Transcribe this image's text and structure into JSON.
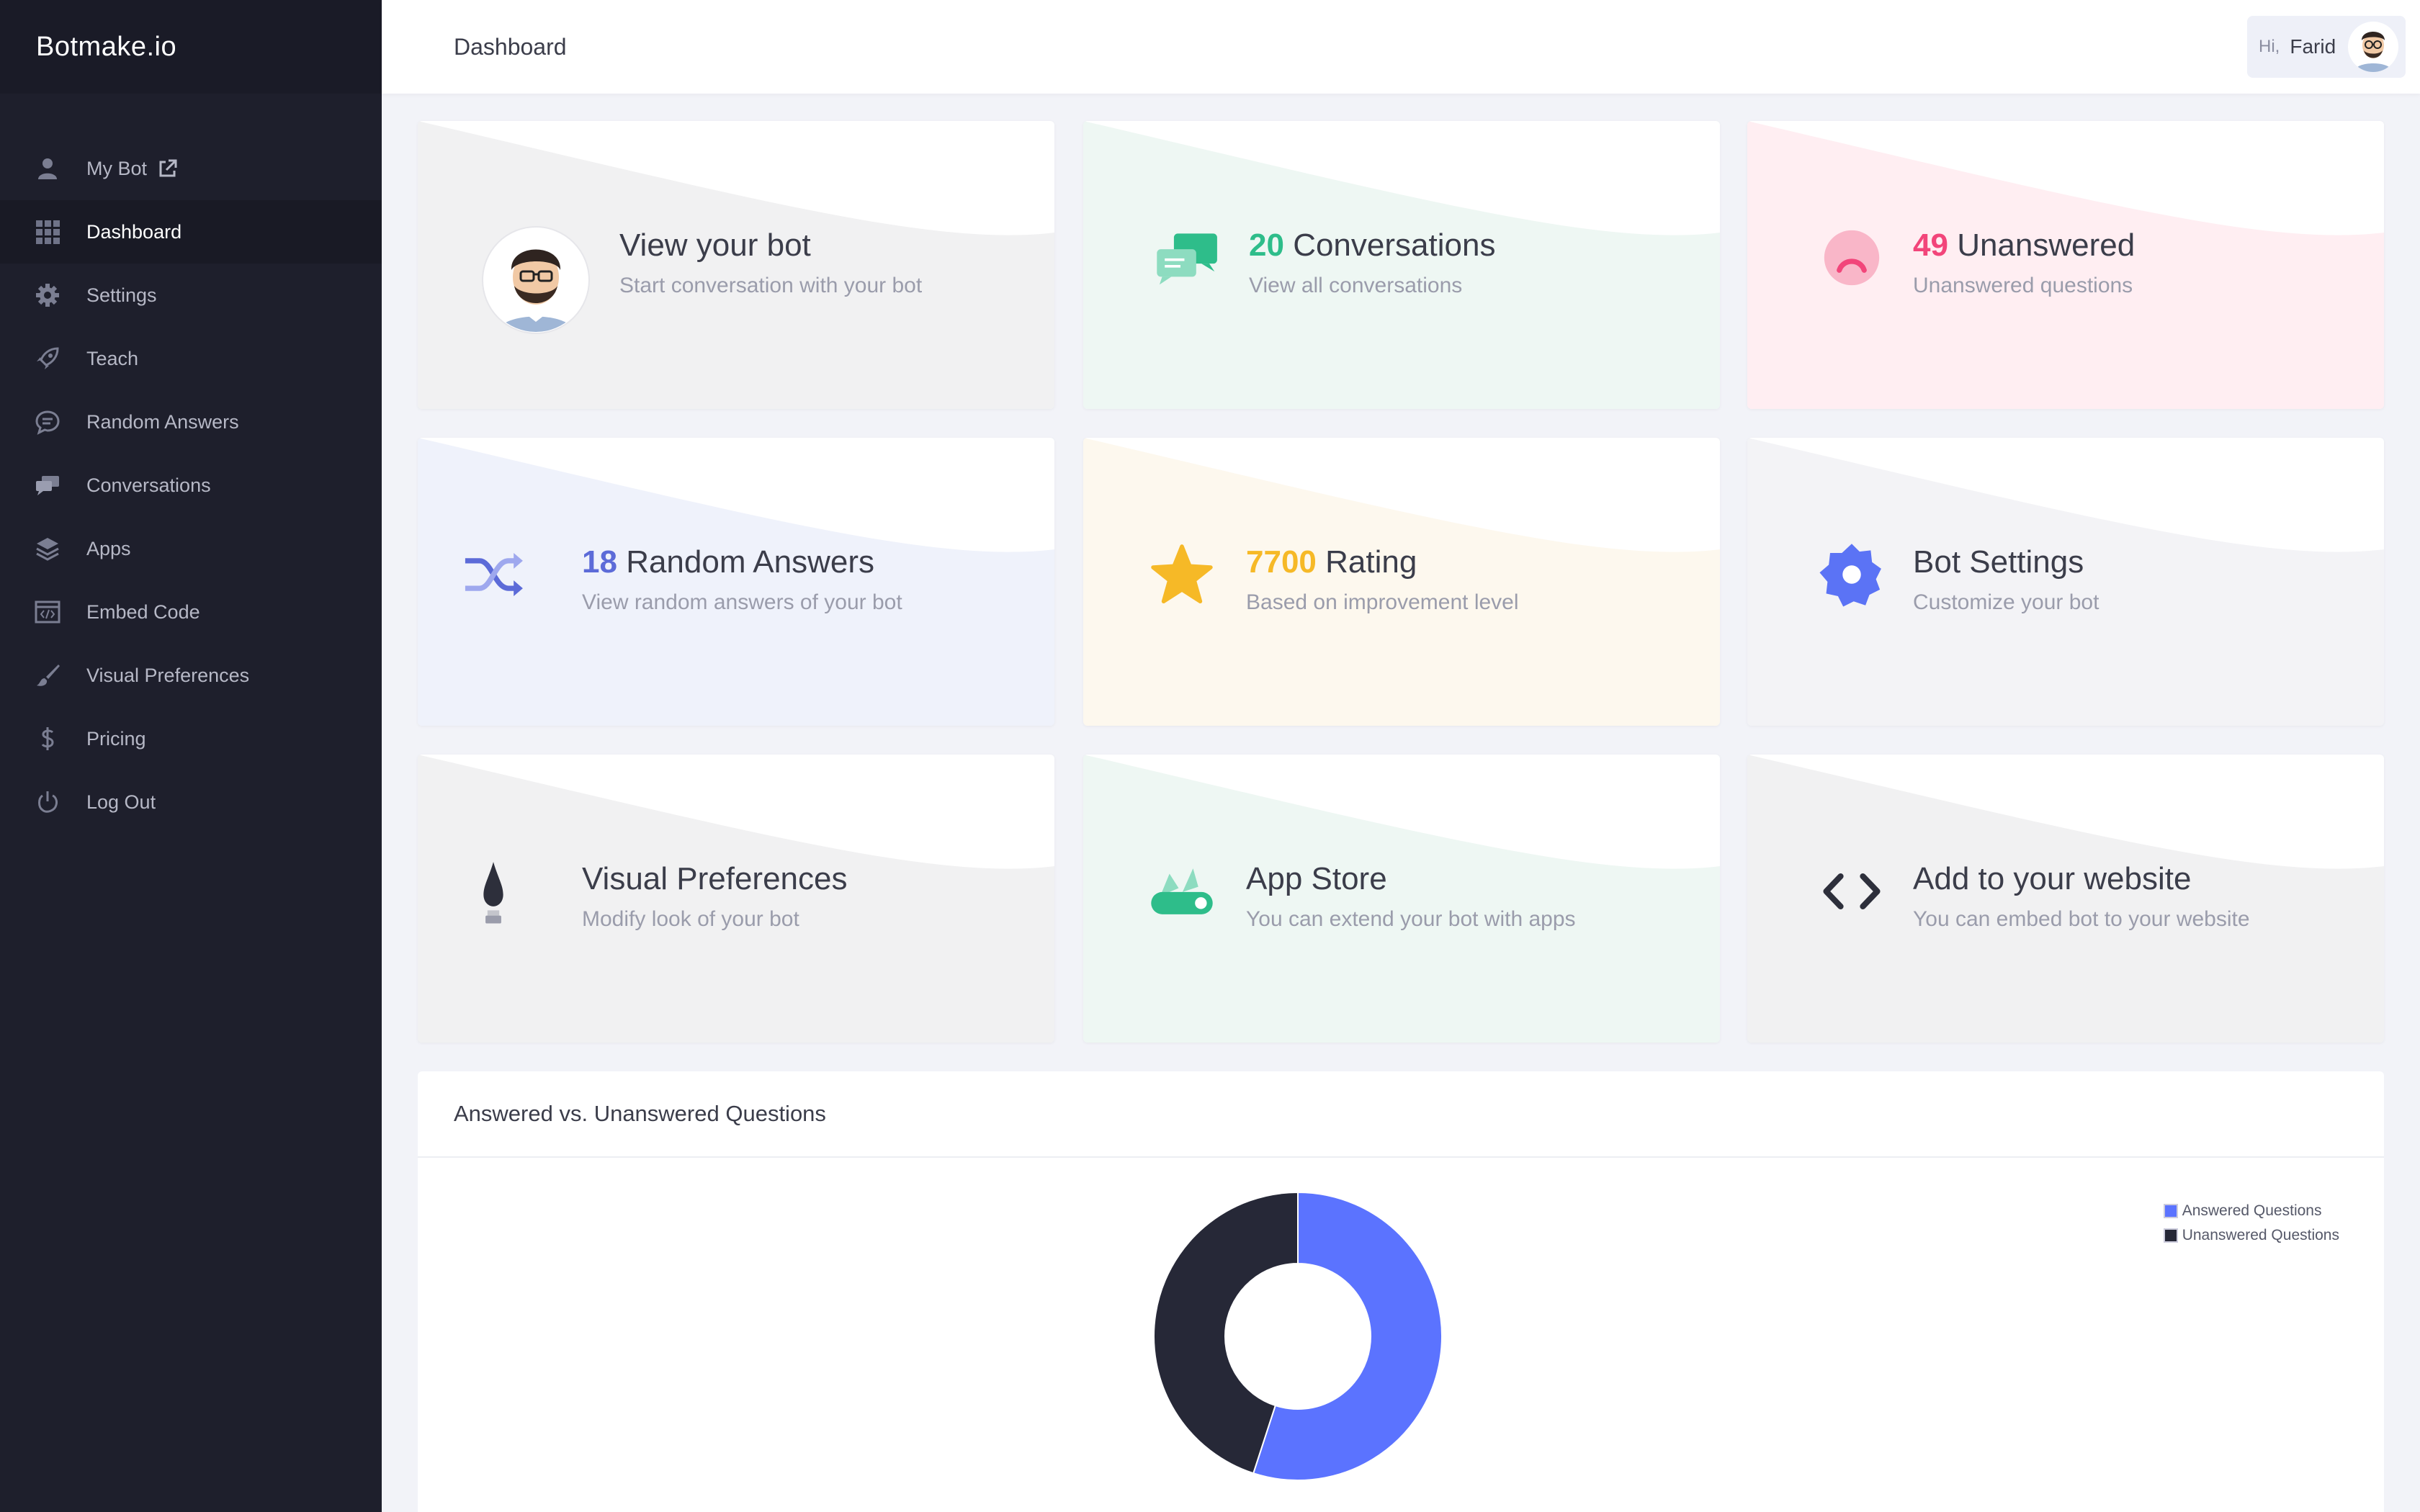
{
  "brand": "Botmake.io",
  "header": {
    "title": "Dashboard",
    "greeting": "Hi,",
    "user_name": "Farid"
  },
  "sidebar": {
    "items": [
      {
        "label": "My Bot",
        "icon": "user-icon"
      },
      {
        "label": "Dashboard",
        "icon": "grid-icon",
        "active": true
      },
      {
        "label": "Settings",
        "icon": "gear-icon"
      },
      {
        "label": "Teach",
        "icon": "rocket-icon"
      },
      {
        "label": "Random Answers",
        "icon": "chat-bubble-icon"
      },
      {
        "label": "Conversations",
        "icon": "comments-icon"
      },
      {
        "label": "Apps",
        "icon": "layers-icon"
      },
      {
        "label": "Embed Code",
        "icon": "code-window-icon"
      },
      {
        "label": "Visual Preferences",
        "icon": "brush-icon"
      },
      {
        "label": "Pricing",
        "icon": "dollar-icon"
      },
      {
        "label": "Log Out",
        "icon": "power-icon"
      }
    ]
  },
  "cards": [
    {
      "num": "",
      "title": "View your bot",
      "sub": "Start conversation with your bot",
      "icon": "bot-avatar-icon",
      "color": "#3b3d4a"
    },
    {
      "num": "20",
      "title": "Conversations",
      "sub": "View all conversations",
      "icon": "conversations-icon",
      "color": "#2ebd8a"
    },
    {
      "num": "49",
      "title": "Unanswered",
      "sub": "Unanswered questions",
      "icon": "sad-face-icon",
      "color": "#f2457a"
    },
    {
      "num": "18",
      "title": "Random Answers",
      "sub": "View random answers of your bot",
      "icon": "shuffle-icon",
      "color": "#5c6bd8"
    },
    {
      "num": "7700",
      "title": "Rating",
      "sub": "Based on improvement level",
      "icon": "star-icon",
      "color": "#f6b927"
    },
    {
      "num": "",
      "title": "Bot Settings",
      "sub": "Customize your bot",
      "icon": "settings-badge-icon",
      "color": "#5b73f5"
    },
    {
      "num": "",
      "title": "Visual Preferences",
      "sub": "Modify look of your bot",
      "icon": "paint-drop-icon",
      "color": "#2d2f3b"
    },
    {
      "num": "",
      "title": "App Store",
      "sub": "You can extend your bot with apps",
      "icon": "toggle-app-icon",
      "color": "#2ebd8a"
    },
    {
      "num": "",
      "title": "Add to your website",
      "sub": "You can embed bot to your website",
      "icon": "code-brackets-icon",
      "color": "#2d2f3b"
    }
  ],
  "chart_panel": {
    "title": "Answered vs. Unanswered Questions"
  },
  "chart_data": {
    "type": "pie",
    "title": "Answered vs. Unanswered Questions",
    "categories": [
      "Answered Questions",
      "Unanswered Questions"
    ],
    "values": [
      55,
      45
    ],
    "colors": [
      "#5b73ff",
      "#262837"
    ],
    "donut": true,
    "legend": "top-right"
  }
}
